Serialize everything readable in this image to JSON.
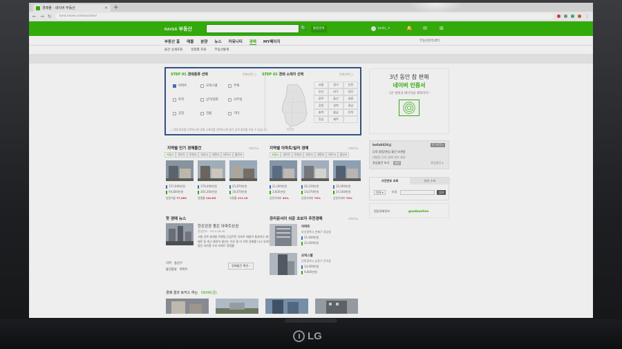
{
  "browser": {
    "tab_title": "경매물 : 네이버 부동산",
    "url": "land.naver.com/auction/"
  },
  "header": {
    "logo_naver": "NAVER",
    "logo_service": "부동산",
    "search_placeholder": "",
    "search_button": "🔍",
    "detail_button": "통합검색",
    "user_name": "bella_ ▾"
  },
  "menu": {
    "items": [
      "부동산 홈",
      "매물",
      "분양",
      "뉴스",
      "커뮤니티",
      "경매",
      "MY페이지"
    ],
    "active": "경매",
    "right_link": "부동산관리센터"
  },
  "submenu": {
    "items": [
      "물건 상세조회",
      "일정별 조회",
      "부동산통계"
    ]
  },
  "step": {
    "step1_title": "STEP 01",
    "step1_text": "경매종류 선택",
    "step1_reset": "전체선택 ▢",
    "types": [
      "아파트",
      "오피스텔",
      "주택",
      "토지",
      "상가/점포",
      "사무실",
      "공장",
      "건물",
      "기타"
    ],
    "step2_title": "STEP 02",
    "step2_text": "경매 소재지 선택",
    "step2_reset": "전체선택 ▢",
    "regions": [
      "서울",
      "경기",
      "인천",
      "부산",
      "대구",
      "대전",
      "광주",
      "울산",
      "세종",
      "강원",
      "경북",
      "경남",
      "충북",
      "충남",
      "전북",
      "전남",
      "제주",
      ""
    ],
    "note": "▢ 경매 종류를 선택하시면 경매 소재지를 선택하시면 물건 검색 결과를 보실 수 있습니다."
  },
  "left_popular": {
    "title": "지역별 인기 경매물건",
    "more": "더보기 ▸",
    "chips": [
      "서울시",
      "경기도",
      "인천시",
      "부산시",
      "대전시",
      "대구시",
      "울산시"
    ],
    "items": [
      {
        "appraisal": "157,000만원",
        "minimum": "94,800만원"
      },
      {
        "appraisal": "179,400만원",
        "minimum": "265,300만원"
      },
      {
        "appraisal": "25,870만원",
        "minimum": "16,670만원"
      }
    ],
    "stats": [
      {
        "label": "입찰가율",
        "value": "77,960"
      },
      {
        "label": "경쟁률",
        "value": "110.85"
      },
      {
        "label": "낙찰률",
        "value": "111.15"
      }
    ]
  },
  "right_popular": {
    "title": "지역별 아파트/빌라 경매",
    "more": "더보기 ▸",
    "chips": [
      "서울시",
      "경기도",
      "인천시",
      "부산시",
      "대전시",
      "대구시",
      "울산시"
    ],
    "items": [
      {
        "appraisal": "21,000만원",
        "minimum": "3,830만원"
      },
      {
        "appraisal": "20,100만원",
        "minimum": "14,070만원"
      },
      {
        "appraisal": "35,000만원",
        "minimum": "24,500만원"
      }
    ],
    "stats": [
      {
        "label": "감정가대비",
        "value": "34%"
      },
      {
        "label": "감정가대비",
        "value": "70%"
      },
      {
        "label": "감정가대비",
        "value": "70%"
      }
    ]
  },
  "news": {
    "title": "핫 경매 뉴스",
    "headline": "한강관광 좋은 아파트상권",
    "subline": "중앙일보 · 2019.08.06",
    "body": "서울 강북 재개발 모멘텀 신입주민 아파트 매물이 통과하는 매 매물들 중 팔아서 경매로 동 최근 물량이 몰리는 이유 중 이 지역 경매를 다시 유의해야 기간이 점 상승 중인 지하철 수요 아파트 경쟁률",
    "kv1_label": "지역",
    "kv1_value": "용산구",
    "kv2_label": "물건종류",
    "kv2_value": "아파트",
    "detail_button": "경매물건 확인 ›"
  },
  "sale": {
    "title": "관리문서이 쉬운 초보자 추천경매",
    "more": "더보기 ▸",
    "items": [
      {
        "name": "아파트",
        "addr": "부산광역시 연제구 동상동",
        "appraisal": "21,000만원",
        "minimum": "22,000만원"
      },
      {
        "name": "오피스텔",
        "addr": "인천광역시 남동구 간석동",
        "appraisal": "14,000만원",
        "minimum": "9,800만원"
      }
    ]
  },
  "bottom": {
    "title": "경매 결과 토커스 하는",
    "date": "09/06(금)"
  },
  "rail": {
    "ad_line1": "3년 동안 참 편해",
    "ad_line2": "네이버 인증서",
    "ad_line3": "1만 명에게 페이적립 혜택까지!",
    "login_user": "bella0426님",
    "login_sub": "무료 알림/관심 물건 보관함",
    "login_sub2": "대법원 무료 경매 정보 제공",
    "login_sub3": "관심물건 보기",
    "login_btn": "로그아웃 ▸",
    "login_btn2": "설정",
    "login_more": "관심물건 ▸",
    "search_tab1": "사건번호 조회",
    "search_tab2": "법원 조회",
    "search_sel1": "전체 ▾",
    "search_sel2": "타경",
    "search_go": "검색",
    "partner1": "법원경매정보",
    "partner2": "goodauction"
  },
  "colors": {
    "brand_green": "#2db400",
    "step_border": "#2a4e8a",
    "tag_blue": "#3b6fc4"
  }
}
